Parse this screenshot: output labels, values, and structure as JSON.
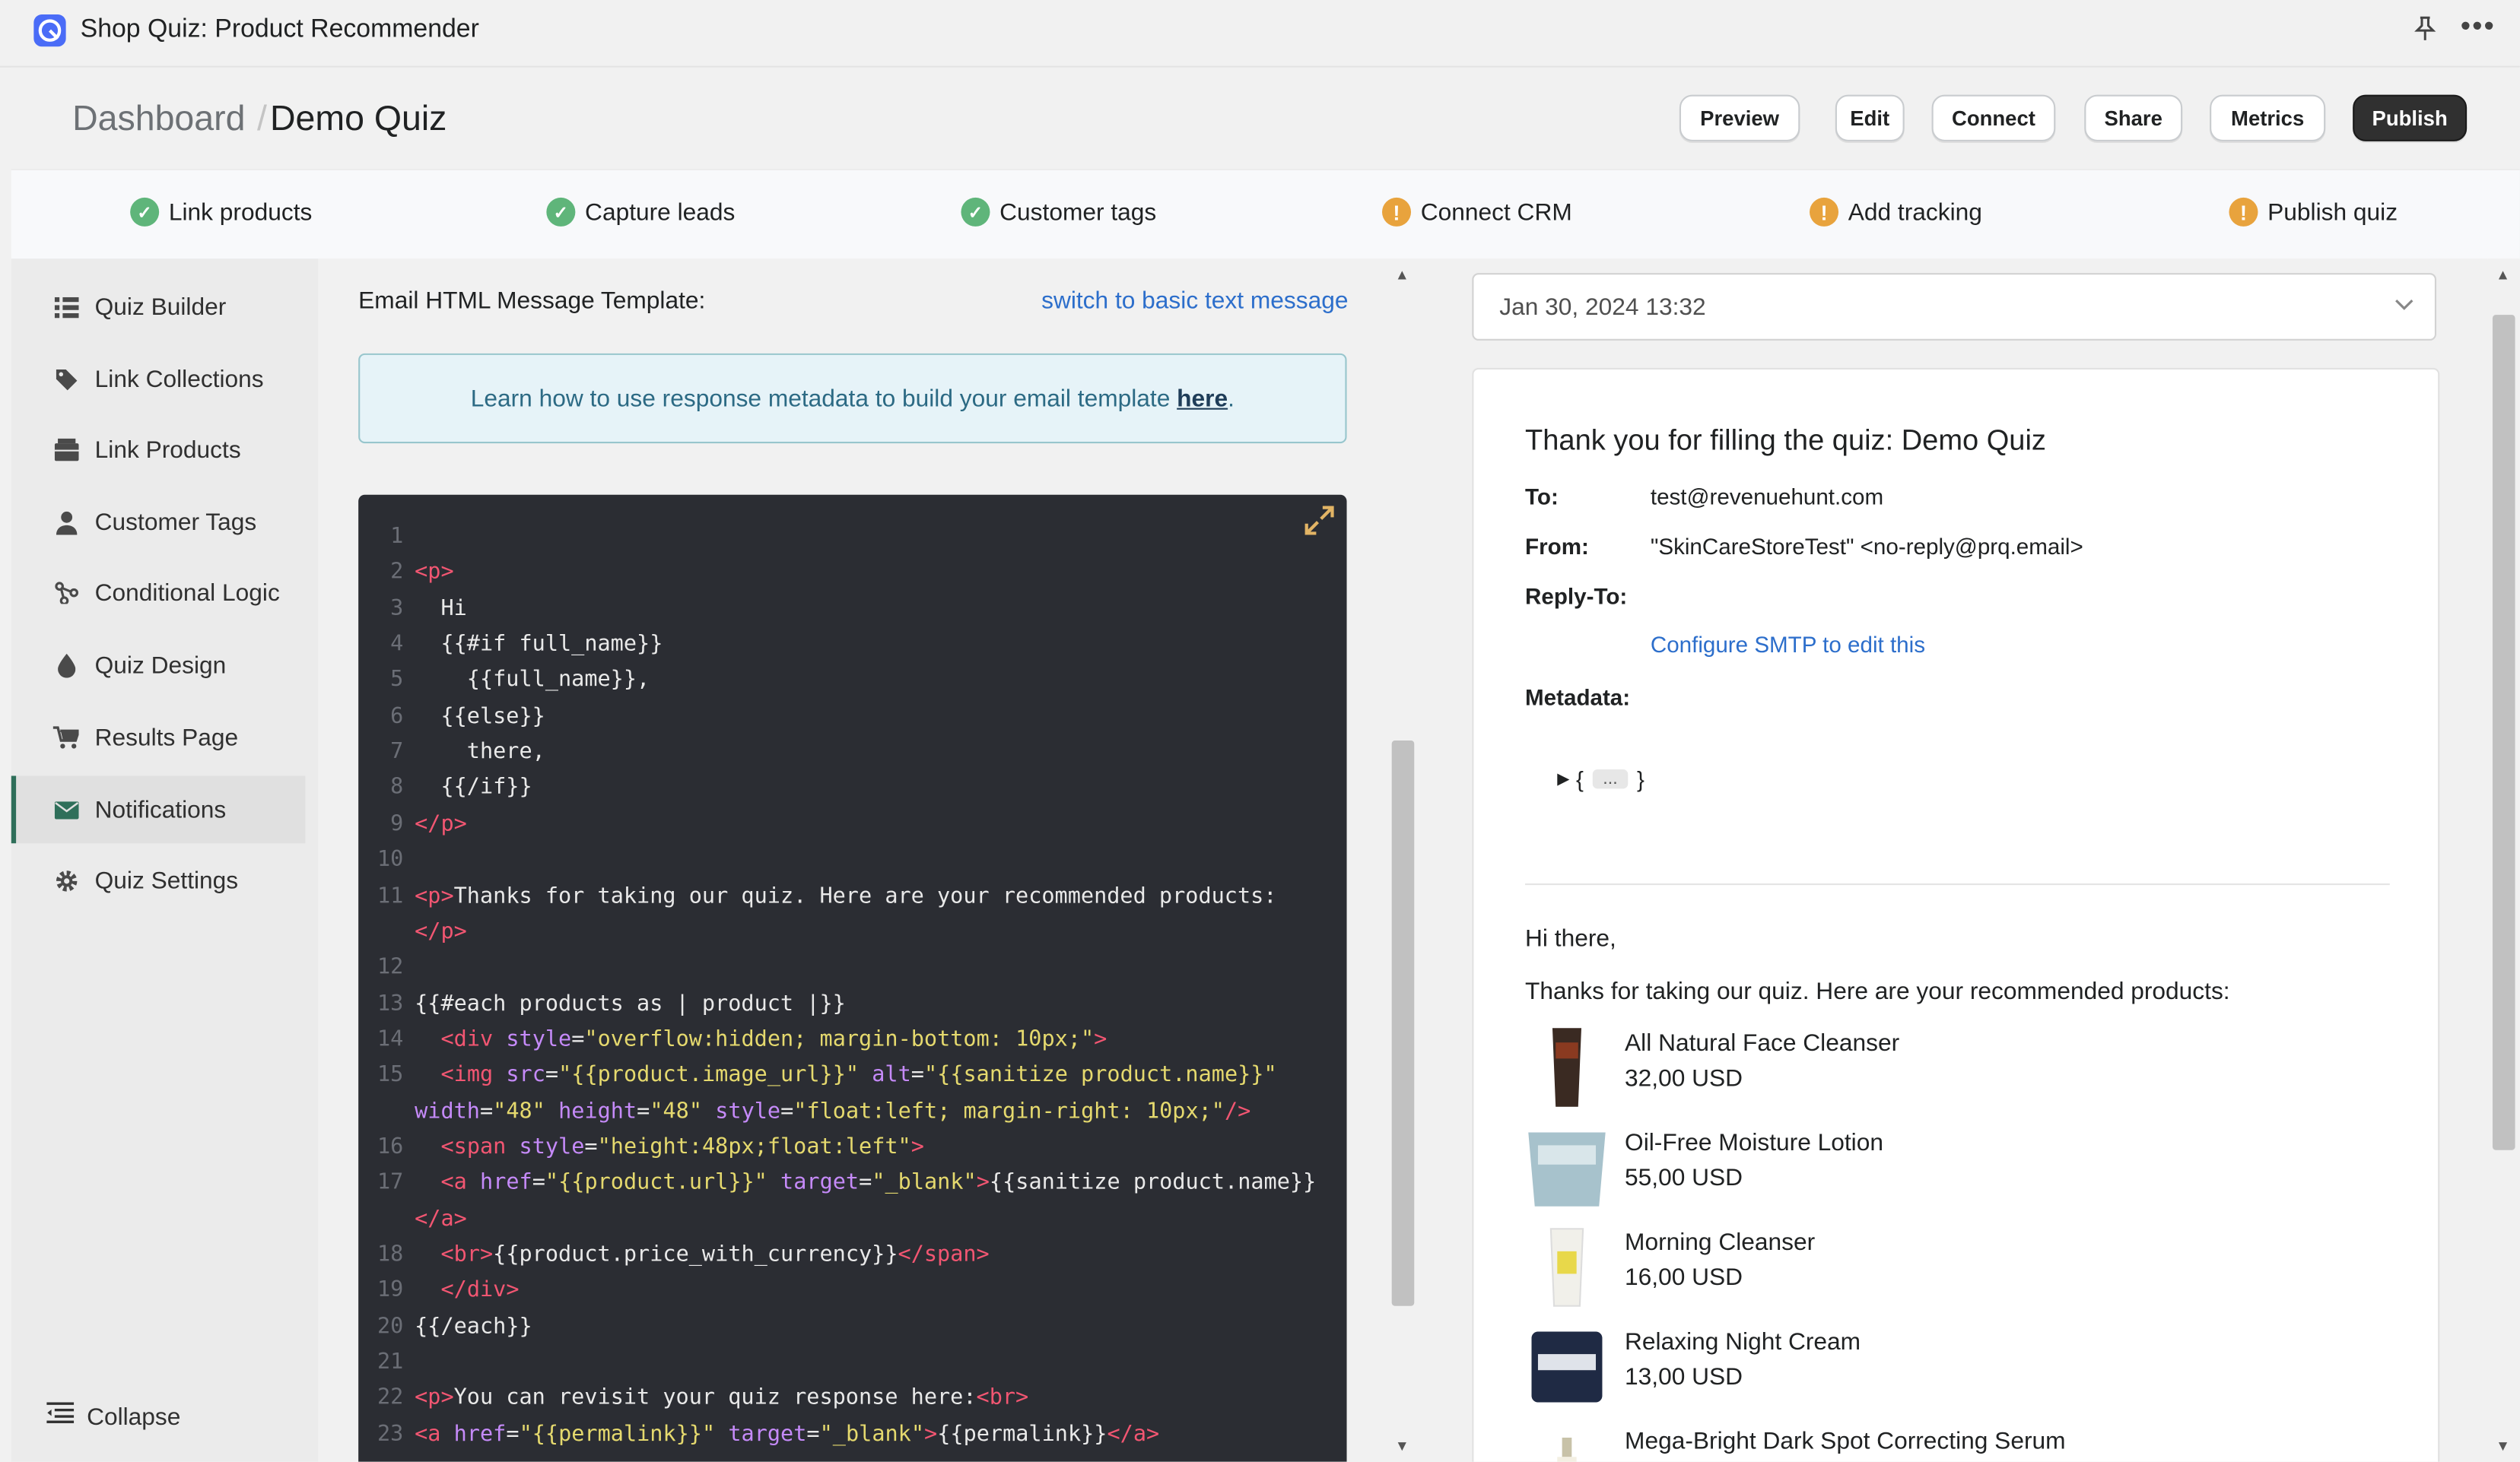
{
  "app": {
    "title": "Shop Quiz: Product Recommender",
    "icons": {
      "logo": "app-logo-icon",
      "pin": "pin-icon",
      "more": "more-horizontal-icon"
    }
  },
  "header": {
    "breadcrumb_root": "Dashboard",
    "breadcrumb_sep": "/",
    "breadcrumb_current": "Demo Quiz",
    "buttons": {
      "preview": "Preview",
      "edit": "Edit",
      "connect": "Connect",
      "share": "Share",
      "metrics": "Metrics",
      "publish": "Publish"
    }
  },
  "steps": [
    {
      "label": "Link products",
      "status": "done"
    },
    {
      "label": "Capture leads",
      "status": "done"
    },
    {
      "label": "Customer tags",
      "status": "done"
    },
    {
      "label": "Connect CRM",
      "status": "warning"
    },
    {
      "label": "Add tracking",
      "status": "warning"
    },
    {
      "label": "Publish quiz",
      "status": "warning"
    }
  ],
  "sidebar": {
    "items": [
      {
        "label": "Quiz Builder",
        "icon": "list-icon"
      },
      {
        "label": "Link Collections",
        "icon": "tag-icon"
      },
      {
        "label": "Link Products",
        "icon": "box-icon"
      },
      {
        "label": "Customer Tags",
        "icon": "person-icon"
      },
      {
        "label": "Conditional Logic",
        "icon": "branch-icon"
      },
      {
        "label": "Quiz Design",
        "icon": "droplet-icon"
      },
      {
        "label": "Results Page",
        "icon": "cart-icon"
      },
      {
        "label": "Notifications",
        "icon": "envelope-icon",
        "active": true
      },
      {
        "label": "Quiz Settings",
        "icon": "gear-icon"
      }
    ],
    "collapse": "Collapse"
  },
  "editor": {
    "label": "Email HTML Message Template:",
    "switch_link": "switch to basic text message",
    "banner_text": "Learn how to use response metadata to build your email template ",
    "banner_link": "here",
    "banner_end": "."
  },
  "code_lines": [
    {
      "n": "1",
      "html": ""
    },
    {
      "n": "2",
      "html": "<span class=\"tag\">&lt;p&gt;</span>"
    },
    {
      "n": "3",
      "html": "  Hi"
    },
    {
      "n": "4",
      "html": "  {{#if full_name}}"
    },
    {
      "n": "5",
      "html": "    {{full_name}},"
    },
    {
      "n": "6",
      "html": "  {{else}}"
    },
    {
      "n": "7",
      "html": "    there,"
    },
    {
      "n": "8",
      "html": "  {{/if}}"
    },
    {
      "n": "9",
      "html": "<span class=\"tag\">&lt;/p&gt;</span>"
    },
    {
      "n": "10",
      "html": ""
    },
    {
      "n": "11",
      "html": "<span class=\"tag\">&lt;p&gt;</span>Thanks for taking our quiz. Here are your recommended products:"
    },
    {
      "n": "",
      "html": "<span class=\"tag\">&lt;/p&gt;</span>"
    },
    {
      "n": "12",
      "html": ""
    },
    {
      "n": "13",
      "html": "{{#each products as | product |}}"
    },
    {
      "n": "14",
      "html": "  <span class=\"tag\">&lt;div</span> <span class=\"attr\">style</span>=<span class=\"str\">\"overflow:hidden; margin-bottom: 10px;\"</span><span class=\"tag\">&gt;</span>"
    },
    {
      "n": "15",
      "html": "  <span class=\"tag\">&lt;img</span> <span class=\"attr\">src</span>=<span class=\"str\">\"{{product.image_url}}\"</span> <span class=\"attr\">alt</span>=<span class=\"str\">\"{{sanitize product.name}}\"</span>"
    },
    {
      "n": "",
      "html": "<span class=\"attr\">width</span>=<span class=\"str\">\"48\"</span> <span class=\"attr\">height</span>=<span class=\"str\">\"48\"</span> <span class=\"attr\">style</span>=<span class=\"str\">\"float:left; margin-right: 10px;\"</span><span class=\"tag\">/&gt;</span>"
    },
    {
      "n": "16",
      "html": "  <span class=\"tag\">&lt;span</span> <span class=\"attr\">style</span>=<span class=\"str\">\"height:48px;float:left\"</span><span class=\"tag\">&gt;</span>"
    },
    {
      "n": "17",
      "html": "  <span class=\"tag\">&lt;a</span> <span class=\"attr\">href</span>=<span class=\"str\">\"{{product.url}}\"</span> <span class=\"attr\">target</span>=<span class=\"str\">\"_blank\"</span><span class=\"tag\">&gt;</span>{{sanitize product.name}}"
    },
    {
      "n": "",
      "html": "<span class=\"tag\">&lt;/a&gt;</span>"
    },
    {
      "n": "18",
      "html": "  <span class=\"tag\">&lt;br&gt;</span>{{product.price_with_currency}}<span class=\"tag\">&lt;/span&gt;</span>"
    },
    {
      "n": "19",
      "html": "  <span class=\"tag\">&lt;/div&gt;</span>"
    },
    {
      "n": "20",
      "html": "{{/each}}"
    },
    {
      "n": "21",
      "html": ""
    },
    {
      "n": "22",
      "html": "<span class=\"tag\">&lt;p&gt;</span>You can revisit your quiz response here:<span class=\"tag\">&lt;br&gt;</span>"
    },
    {
      "n": "23",
      "html": "<span class=\"tag\">&lt;a</span> <span class=\"attr\">href</span>=<span class=\"str\">\"{{permalink}}\"</span> <span class=\"attr\">target</span>=<span class=\"str\">\"_blank\"</span><span class=\"tag\">&gt;</span>{{permalink}}<span class=\"tag\">&lt;/a&gt;</span>"
    }
  ],
  "preview": {
    "date": "Jan 30, 2024 13:32",
    "subject": "Thank you for filling the quiz: Demo Quiz",
    "to_label": "To:",
    "to_value": "test@revenuehunt.com",
    "from_label": "From:",
    "from_value": "\"SkinCareStoreTest\" <no-reply@prq.email>",
    "reply_label": "Reply-To:",
    "smtp_link": "Configure SMTP to edit this",
    "metadata_label": "Metadata:",
    "metadata_open": "{",
    "metadata_dots": "...",
    "metadata_close": "}",
    "greeting": "Hi there,",
    "thanks": "Thanks for taking our quiz. Here are your recommended products:",
    "products": [
      {
        "name": "All Natural Face Cleanser",
        "price": "32,00 USD"
      },
      {
        "name": "Oil-Free Moisture Lotion",
        "price": "55,00 USD"
      },
      {
        "name": "Morning Cleanser",
        "price": "16,00 USD"
      },
      {
        "name": "Relaxing Night Cream",
        "price": "13,00 USD"
      },
      {
        "name": "Mega-Bright Dark Spot Correcting Serum",
        "price": ""
      }
    ]
  }
}
